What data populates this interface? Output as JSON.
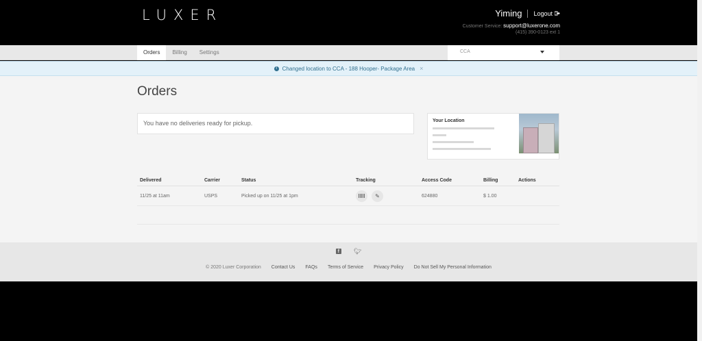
{
  "header": {
    "logo": "LUXER",
    "user_name": "Yiming",
    "logout_label": "Logout",
    "cs_label": "Customer Service:",
    "cs_email": "support@luxerone.com",
    "cs_phone": "(415) 390-0123 ext 1"
  },
  "nav": {
    "tabs": [
      {
        "label": "Orders",
        "active": true
      },
      {
        "label": "Billing",
        "active": false
      },
      {
        "label": "Settings",
        "active": false
      }
    ],
    "location_select": "CCA"
  },
  "alert": {
    "message": "Changed location to CCA - 188 Hooper- Package Area",
    "close_icon": "×"
  },
  "main": {
    "title": "Orders",
    "empty_message": "You have no deliveries ready for pickup.",
    "location_card": {
      "label": "Your Location"
    },
    "table": {
      "headers": [
        "Delivered",
        "Carrier",
        "Status",
        "Tracking",
        "Access Code",
        "Billing",
        "Actions"
      ],
      "rows": [
        {
          "delivered": "11/25 at 11am",
          "carrier": "USPS",
          "status": "Picked up on 11/25 at 1pm",
          "access_code": "624880",
          "billing": "$ 1.00"
        }
      ]
    }
  },
  "footer": {
    "social": [
      "facebook-icon",
      "twitter-icon"
    ],
    "copyright": "© 2020 Luxer Corporation",
    "links": [
      "Contact Us",
      "FAQs",
      "Terms of Service",
      "Privacy Policy",
      "Do Not Sell My Personal Information"
    ]
  },
  "colors": {
    "alert_bg": "#e3f1f9",
    "alert_text": "#31708f",
    "header_bg": "#000000"
  }
}
